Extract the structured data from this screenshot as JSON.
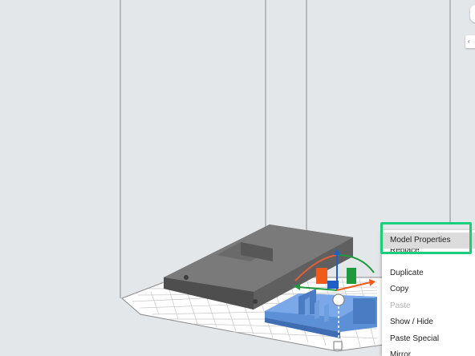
{
  "context_menu": {
    "items": [
      {
        "label": "Model Properties",
        "state": "highlighted"
      },
      {
        "label": "Replace...",
        "state": "partially-hidden"
      },
      {
        "label": "Duplicate",
        "state": "enabled"
      },
      {
        "label": "Copy",
        "state": "enabled"
      },
      {
        "label": "Paste",
        "state": "disabled"
      },
      {
        "label": "Show / Hide",
        "state": "enabled"
      },
      {
        "label": "Paste Special",
        "state": "enabled"
      },
      {
        "label": "Mirror",
        "state": "partially-hidden"
      }
    ]
  },
  "colors": {
    "background": "#e4e7ea",
    "selected_model": "#5b8fd6",
    "other_model": "#6e6e6e",
    "highlight_outline": "#1bcf7a",
    "gizmo_orange": "#f05a1a",
    "gizmo_green": "#1e9a3c",
    "gizmo_blue": "#1f5fc4"
  },
  "icons": [
    "chevron-left-icon",
    "translate-gizmo",
    "rotate-gizmo"
  ]
}
